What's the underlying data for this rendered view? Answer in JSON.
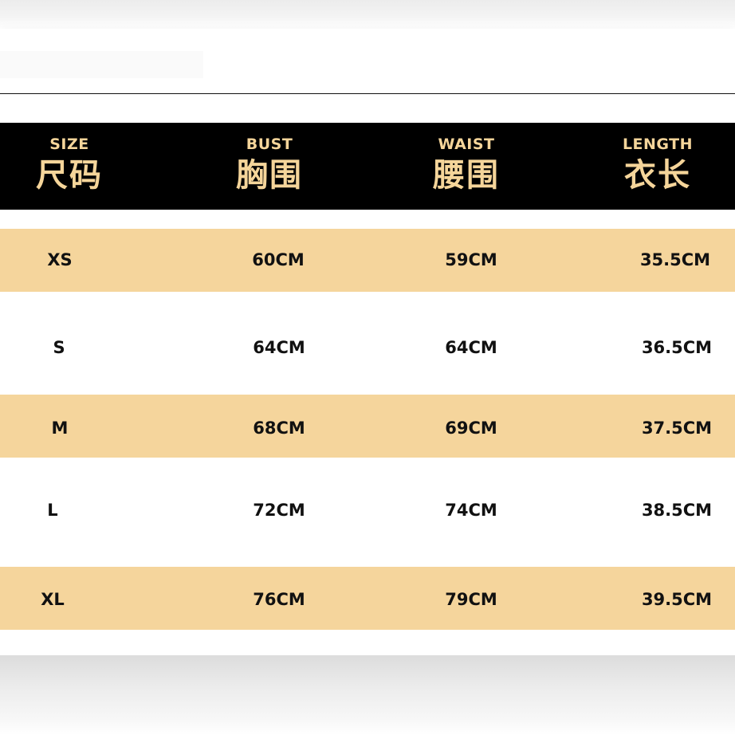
{
  "table": {
    "headers": [
      {
        "en": "SIZE",
        "zh": "尺码"
      },
      {
        "en": "BUST",
        "zh": "胸围"
      },
      {
        "en": "WAIST",
        "zh": "腰围"
      },
      {
        "en": "LENGTH",
        "zh": "衣长"
      }
    ],
    "rows": [
      [
        "XS",
        "60CM",
        "59CM",
        "35.5CM"
      ],
      [
        "S",
        "64CM",
        "64CM",
        "36.5CM"
      ],
      [
        "M",
        "68CM",
        "69CM",
        "37.5CM"
      ],
      [
        "L",
        "72CM",
        "74CM",
        "38.5CM"
      ],
      [
        "XL",
        "76CM",
        "79CM",
        "39.5CM"
      ]
    ]
  },
  "colors": {
    "header_background": "#000000",
    "header_text": "#f5d59a",
    "row_highlight": "#f5d59c",
    "row_text": "#111111"
  }
}
